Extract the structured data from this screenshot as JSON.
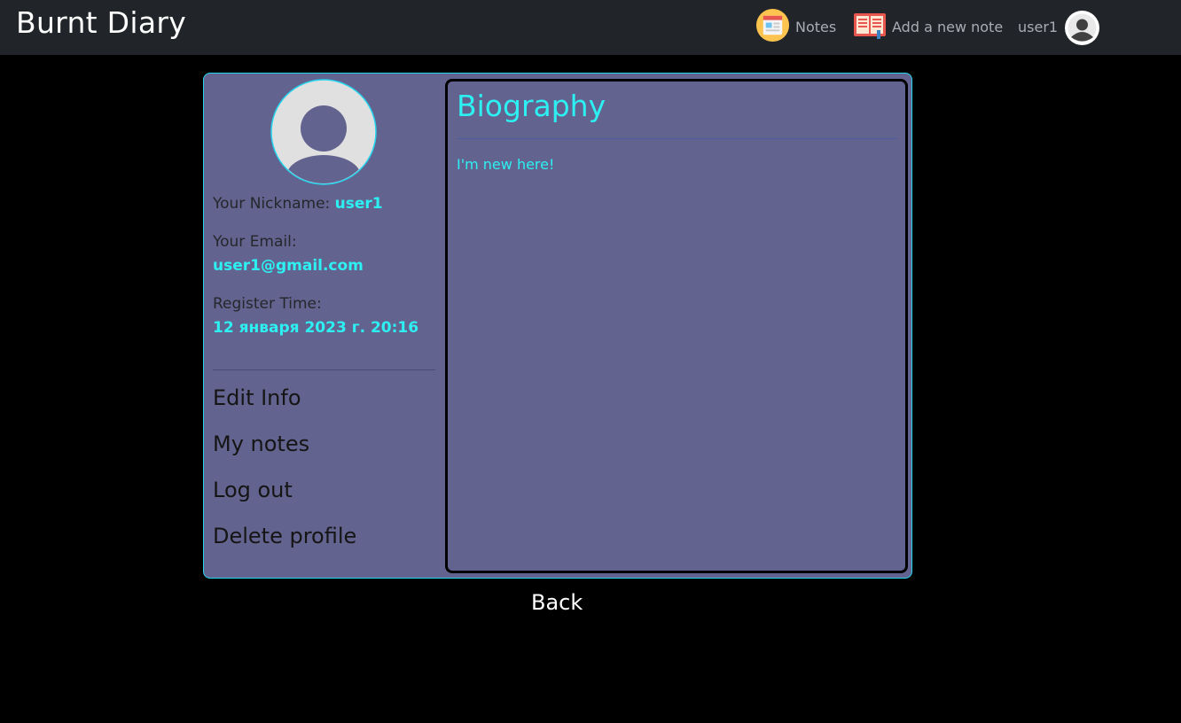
{
  "navbar": {
    "brand": "Burnt Diary",
    "notes_label": "Notes",
    "notes_icon": "news-icon",
    "add_note_label": "Add a new note",
    "add_note_icon": "notebook-icon",
    "username": "user1",
    "avatar_icon": "user-avatar-icon"
  },
  "profile": {
    "nickname_label": "Your Nickname:",
    "nickname": "user1",
    "email_label": "Your Email:",
    "email": "user1@gmail.com",
    "register_label": "Register Time:",
    "register_time": "12 января 2023 г. 20:16",
    "menu": [
      {
        "label": "Edit Info"
      },
      {
        "label": "My notes"
      },
      {
        "label": "Log out"
      },
      {
        "label": "Delete profile"
      }
    ]
  },
  "biography": {
    "title": "Biography",
    "text": "I'm new here!"
  },
  "back_label": "Back",
  "colors": {
    "navbar_bg": "#212529",
    "page_bg": "#000000",
    "card_bg": "#63638f",
    "accent": "#2df0f2",
    "card_border": "#25d6ef"
  }
}
